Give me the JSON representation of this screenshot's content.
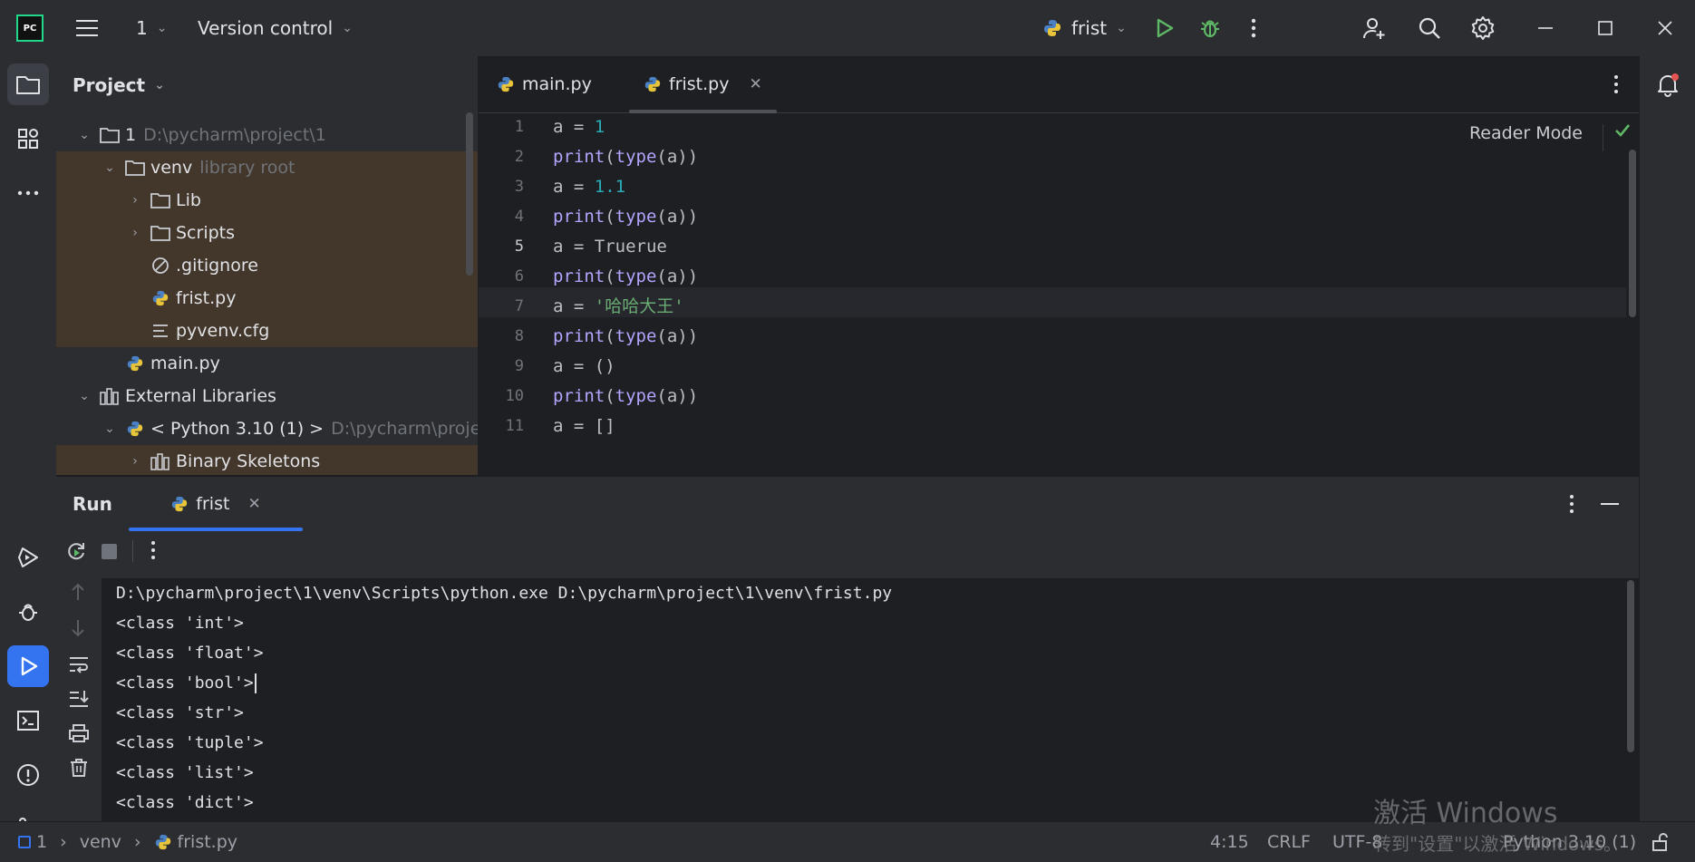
{
  "titlebar": {
    "app_logo": "PC",
    "project_name": "1",
    "vcs_label": "Version control",
    "run_config": "frist"
  },
  "project": {
    "header": "Project",
    "tree": [
      {
        "label": "1",
        "hint": "D:\\pycharm\\project\\1"
      },
      {
        "label": "venv",
        "hint": "library root"
      },
      {
        "label": "Lib"
      },
      {
        "label": "Scripts"
      },
      {
        "label": ".gitignore"
      },
      {
        "label": "frist.py"
      },
      {
        "label": "pyvenv.cfg"
      },
      {
        "label": "main.py"
      },
      {
        "label": "External Libraries"
      },
      {
        "label": "< Python 3.10 (1) >",
        "hint": "D:\\pycharm\\project"
      },
      {
        "label": "Binary Skeletons"
      }
    ]
  },
  "editor": {
    "tabs": [
      {
        "label": "main.py"
      },
      {
        "label": "frist.py"
      }
    ],
    "reader_mode": "Reader Mode",
    "line_numbers": [
      "1",
      "2",
      "3",
      "4",
      "5",
      "6",
      "7",
      "8",
      "9",
      "10",
      "11"
    ],
    "lines": [
      "a = 1",
      "print(type(a))",
      "a = 1.1",
      "print(type(a))",
      "a = Truerue",
      "print(type(a))",
      "a = '哈哈大王'",
      "print(type(a))",
      "a = ()",
      "print(type(a))",
      "a = []"
    ]
  },
  "run": {
    "title": "Run",
    "tab_label": "frist",
    "console": [
      "D:\\pycharm\\project\\1\\venv\\Scripts\\python.exe D:\\pycharm\\project\\1\\venv\\frist.py",
      "<class 'int'>",
      "<class 'float'>",
      "<class 'bool'>",
      "<class 'str'>",
      "<class 'tuple'>",
      "<class 'list'>",
      "<class 'dict'>"
    ]
  },
  "status": {
    "crumb_project": "1",
    "crumb_folder": "venv",
    "crumb_file": "frist.py",
    "position": "4:15",
    "line_sep": "CRLF",
    "encoding": "UTF-8",
    "interpreter": "Python 3.10 (1)"
  },
  "watermark": {
    "line1": "激活 Windows",
    "line2": "转到\"设置\"以激活 Windows。"
  },
  "colors": {
    "accent": "#3574f0",
    "run_green": "#5fb865",
    "highlight_folder": "#43362a"
  }
}
